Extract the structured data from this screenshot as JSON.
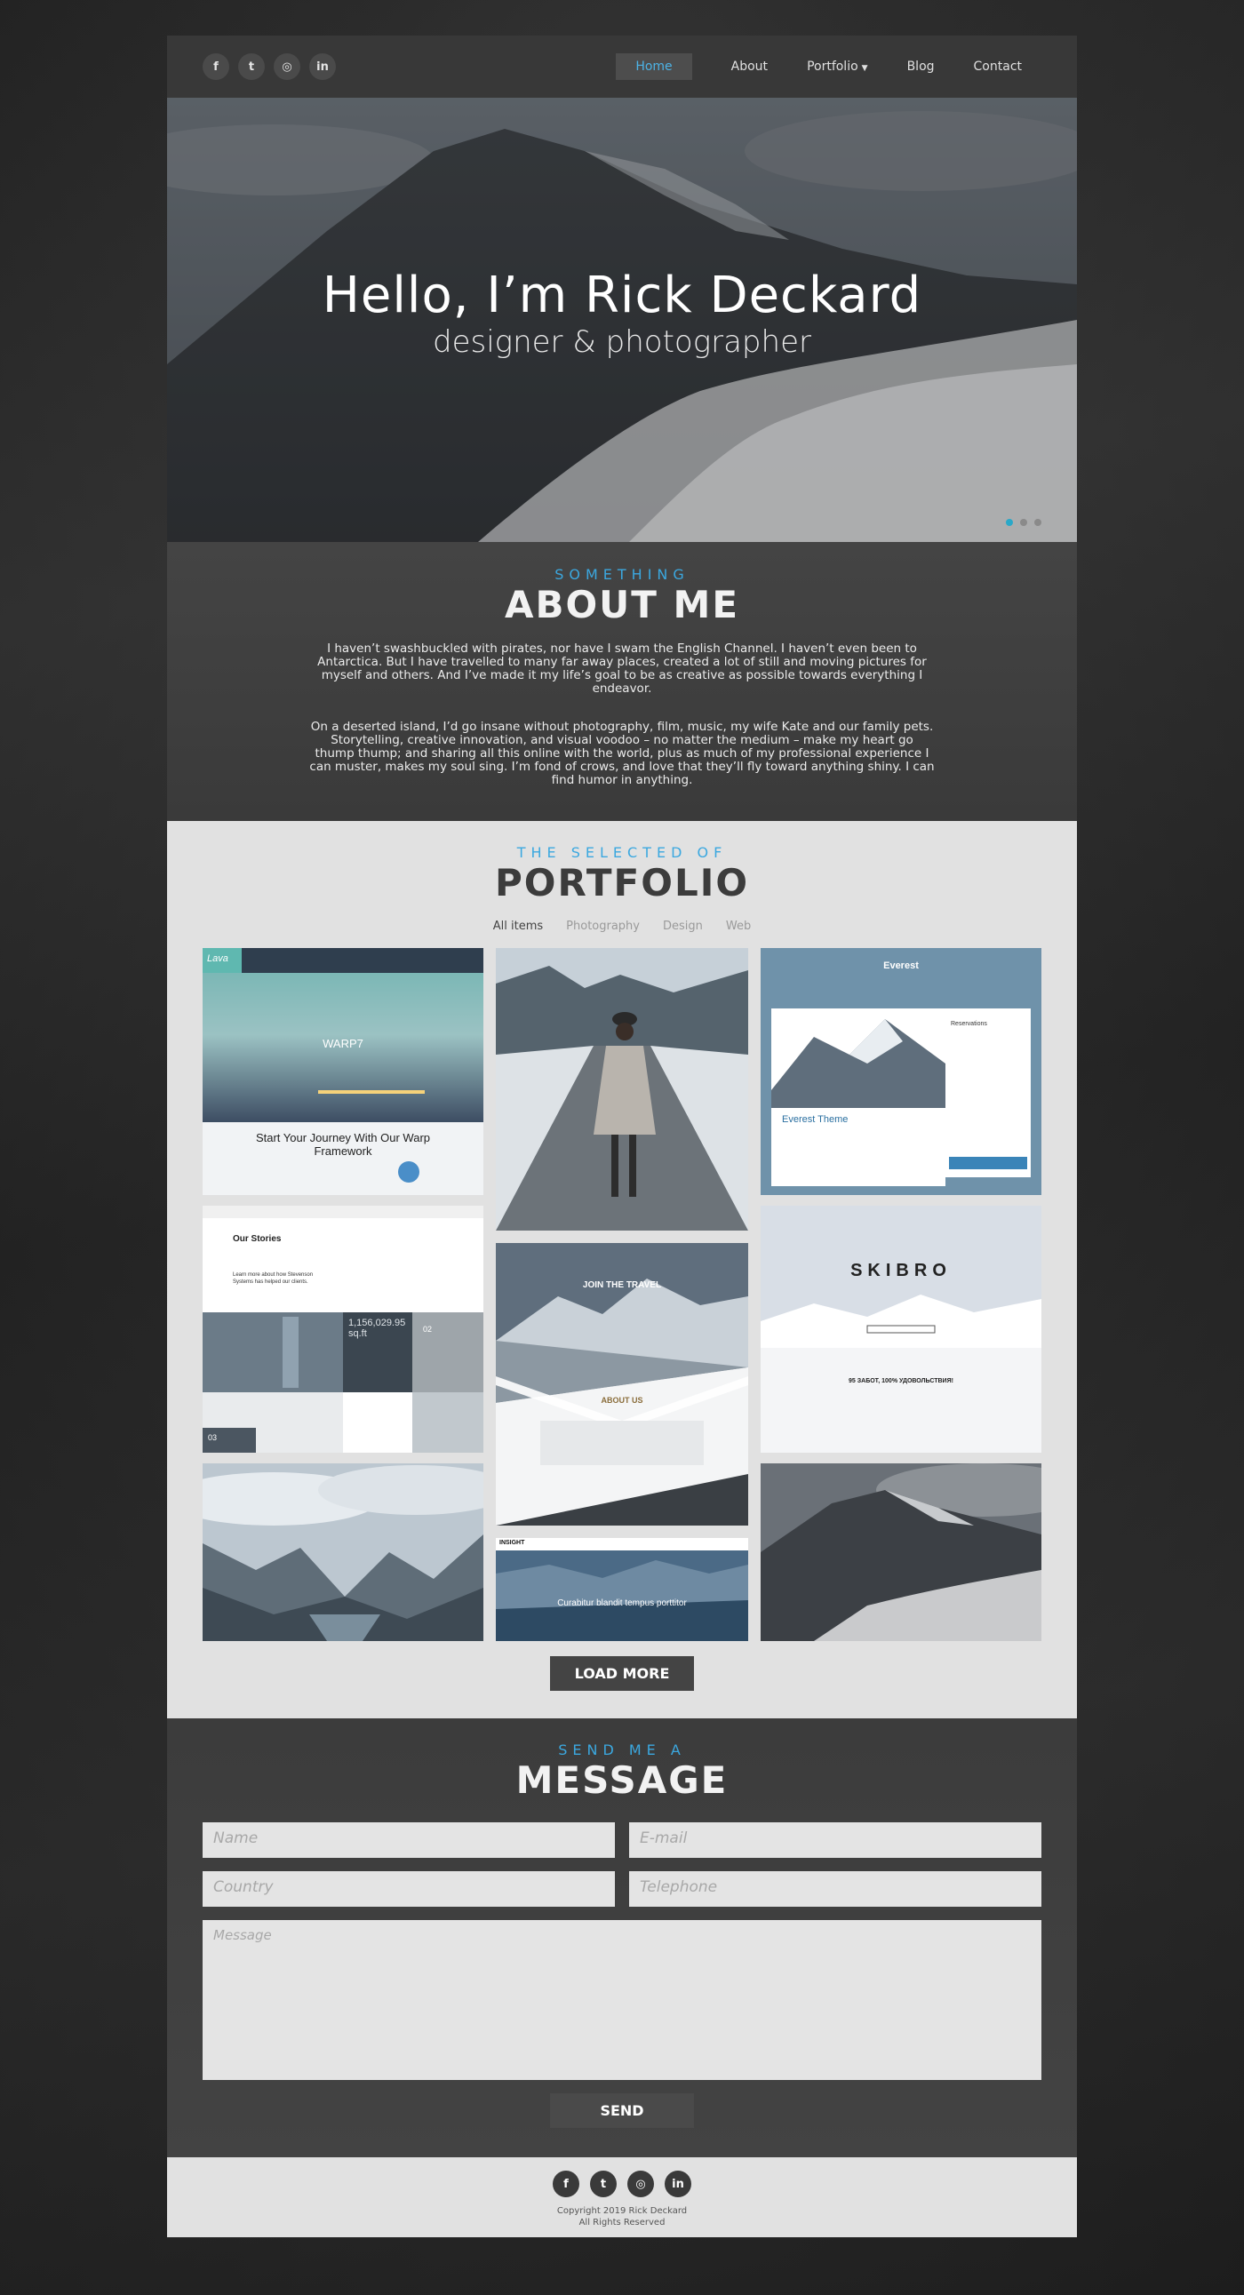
{
  "nav": {
    "socials": [
      {
        "icon": "facebook-icon",
        "glyph": "f"
      },
      {
        "icon": "twitter-icon",
        "glyph": "t"
      },
      {
        "icon": "instagram-icon",
        "glyph": "◎"
      },
      {
        "icon": "linkedin-icon",
        "glyph": "in"
      }
    ],
    "items": [
      {
        "label": "Home"
      },
      {
        "label": "About"
      },
      {
        "label": "Portfolio"
      },
      {
        "label": "Blog"
      },
      {
        "label": "Contact"
      }
    ],
    "active_color": "#4db3e6"
  },
  "hero": {
    "title": "Hello, I’m Rick Deckard",
    "subtitle": "designer & photographer",
    "slides_total": 3,
    "slide_active": 1,
    "dot_active_color": "#2aa8c8"
  },
  "about": {
    "eyebrow": "SOMETHING",
    "title": "ABOUT ME",
    "p1": "I haven’t swashbuckled with pirates, nor have I swam the English Channel. I haven’t even been to Antarctica. But I have travelled to many far away places, created a lot of still and moving pictures for myself and others. And I’ve made it my life’s goal to be as creative as possible towards everything I endeavor.",
    "p2": "On a deserted island, I’d go insane without photography, film, music, my wife Kate and our family pets. Storytelling, creative innovation, and visual voodoo – no matter the medium – make my heart go thump thump; and sharing all this online with the world, plus as much of my professional experience I can muster, makes my soul sing. I’m fond of crows, and love that they’ll fly toward anything shiny. I can find humor in anything."
  },
  "portfolio": {
    "eyebrow": "THE SELECTED OF",
    "title": "PORTFOLIO",
    "filters": [
      {
        "label": "All items"
      },
      {
        "label": "Photography"
      },
      {
        "label": "Design"
      },
      {
        "label": "Web"
      }
    ],
    "tiles": {
      "warp": {
        "logo": "Lava",
        "brand": "WARP7",
        "caption": "Start Your Journey With Our Warp Framework"
      },
      "stories": {
        "title": "Our Stories",
        "tagline": "Learn more about how Stevenson Systems has helped our clients.",
        "stat": "1,156,029.95 sq.ft",
        "badge": "02",
        "badge2": "03"
      },
      "everest": {
        "logo": "Everest",
        "heading": "Everest Theme",
        "panel_title": "Reservations"
      },
      "skibro": {
        "logo": "SKIBRO",
        "tagline": "95 ЗАБОТ, 100% УДОВОЛЬСТВИЯ!"
      },
      "travel": {
        "heading": "JOIN THE TRAVEL",
        "about": "ABOUT US"
      },
      "insight": {
        "logo": "INSIGHT",
        "caption": "Curabitur blandit tempus porttitor"
      }
    },
    "load_more": "LOAD MORE"
  },
  "message": {
    "eyebrow": "SEND ME A",
    "title": "MESSAGE",
    "fields": {
      "name": "Name",
      "email": "E-mail",
      "country": "Country",
      "telephone": "Telephone",
      "message": "Message"
    },
    "send": "SEND"
  },
  "footer": {
    "copyright": "Copyright 2019 Rick Deckard",
    "rights": "All Rights Reserved"
  },
  "colors": {
    "accent": "#3ba8e0",
    "dark": "#3c3c3c",
    "light": "#e1e1e1"
  }
}
